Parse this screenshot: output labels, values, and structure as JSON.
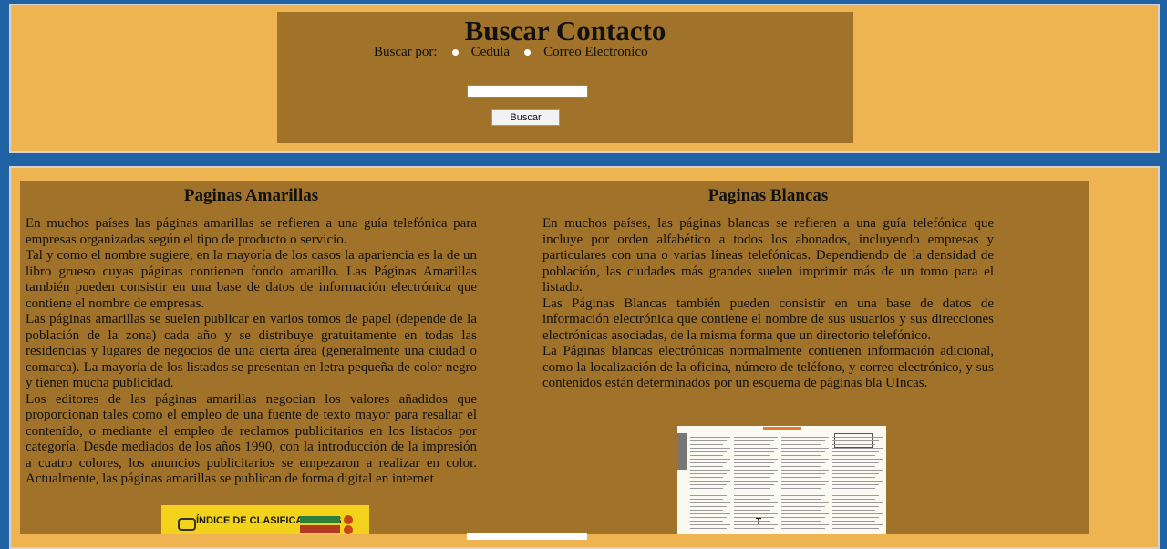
{
  "search": {
    "title": "Buscar Contacto",
    "label": "Buscar por:",
    "options": [
      "Cedula",
      "Correo Electronico"
    ],
    "input_value": "",
    "button_label": "Buscar"
  },
  "columns": {
    "amarillas": {
      "title": "Paginas Amarillas",
      "paragraphs": [
        "En muchos países las páginas amarillas se refieren a una guía telefónica para empresas organizadas según el tipo de producto o servicio.",
        "Tal y como el nombre sugiere, en la mayoría de los casos la apariencia es la de un libro grueso cuyas páginas contienen fondo amarillo. Las Páginas Amarillas también pueden consistir en una base de datos de información electrónica que contiene el nombre de empresas.",
        "Las páginas amarillas se suelen publicar en varios tomos de papel (depende de la población de la zona) cada año y se distribuye gratuitamente en todas las residencias y lugares de negocios de una cierta área (generalmente una ciudad o comarca). La mayoría de los listados se presentan en letra pequeña de color negro y tienen mucha publicidad.",
        "Los editores de las páginas amarillas negocian los valores añadidos que proporcionan tales como el empleo de una fuente de texto mayor para resaltar el contenido, o mediante el empleo de reclamos publicitarios en los listados por categoría. Desde mediados de los años 1990, con la introducción de la impresión a cuatro colores, los anuncios publicitarios se empezaron a realizar en color. Actualmente, las páginas amarillas se publican de forma digital en internet"
      ],
      "image_text": "ÍNDICE DE CLASIFICACIONES"
    },
    "blancas": {
      "title": "Paginas Blancas",
      "paragraphs": [
        "En muchos países, las páginas blancas se refieren a una guía telefónica que incluye por orden alfabético a todos los abonados, incluyendo empresas y particulares con una o varias líneas telefónicas. Dependiendo de la densidad de población, las ciudades más grandes suelen imprimir más de un tomo para el listado.",
        "Las Páginas Blancas también pueden consistir en una base de datos de información electrónica que contiene el nombre de sus usuarios y sus direcciones electrónicas asociadas, de la misma forma que un directorio telefónico.",
        "La Páginas blancas electrónicas normalmente contienen información adicional, como la localización de la oficina, número de teléfono, y correo electrónico, y sus contenidos están determinados por un esquema de páginas bla UIncas."
      ]
    }
  },
  "colors": {
    "page_bg": "#2062a3",
    "panel_bg": "#efb452",
    "box_bg": "#a0722a"
  }
}
